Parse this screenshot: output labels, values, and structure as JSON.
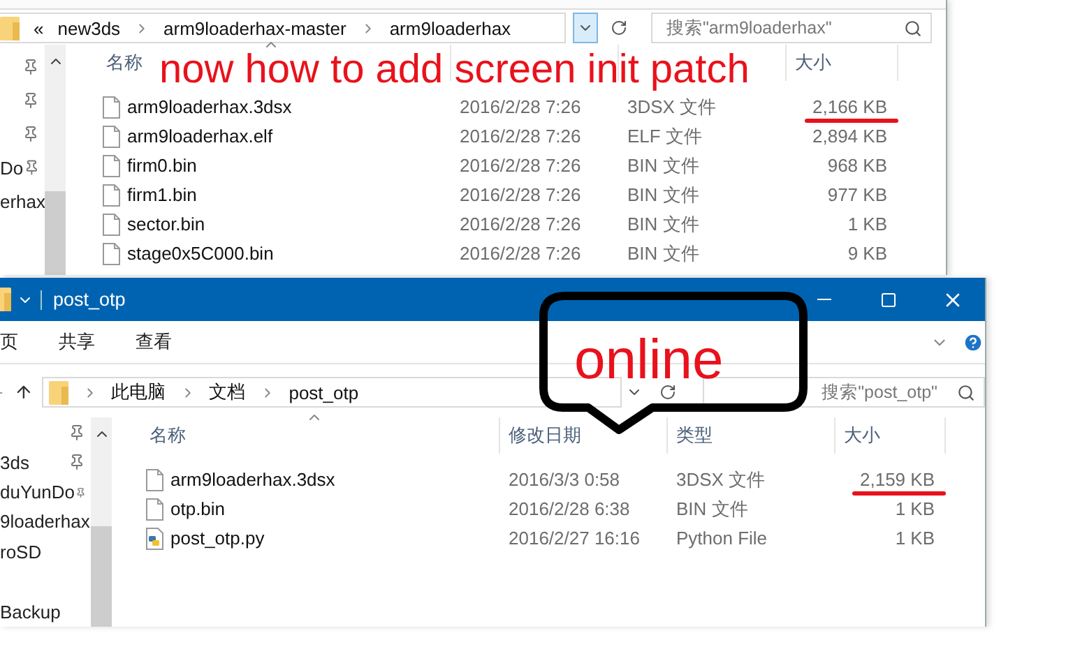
{
  "back_window": {
    "address": {
      "overflow": "«",
      "segments": [
        "new3ds",
        "arm9loaderhax-master",
        "arm9loaderhax"
      ],
      "dropdown_hover": true
    },
    "search": {
      "placeholder": "搜索\"arm9loaderhax\""
    },
    "sidebar": {
      "items": [
        {
          "pinned": true
        },
        {
          "pinned": true
        },
        {
          "pinned": true
        },
        {
          "label": "Do",
          "pinned": true
        },
        {
          "label": "erhax",
          "pinned": false
        }
      ]
    },
    "columns": [
      "名称",
      "大小"
    ],
    "rows": [
      {
        "name": "arm9loaderhax.3dsx",
        "date": "2016/2/28 7:26",
        "type": "3DSX 文件",
        "size": "2,166 KB",
        "underlined": true,
        "kind": "file"
      },
      {
        "name": "arm9loaderhax.elf",
        "date": "2016/2/28 7:26",
        "type": "ELF 文件",
        "size": "2,894 KB",
        "underlined": false,
        "kind": "file"
      },
      {
        "name": "firm0.bin",
        "date": "2016/2/28 7:26",
        "type": "BIN 文件",
        "size": "968 KB",
        "underlined": false,
        "kind": "file"
      },
      {
        "name": "firm1.bin",
        "date": "2016/2/28 7:26",
        "type": "BIN 文件",
        "size": "977 KB",
        "underlined": false,
        "kind": "file"
      },
      {
        "name": "sector.bin",
        "date": "2016/2/28 7:26",
        "type": "BIN 文件",
        "size": "1 KB",
        "underlined": false,
        "kind": "file"
      },
      {
        "name": "stage0x5C000.bin",
        "date": "2016/2/28 7:26",
        "type": "BIN 文件",
        "size": "9 KB",
        "underlined": false,
        "kind": "file"
      }
    ]
  },
  "front_window": {
    "title": "post_otp",
    "ribbon_tabs": [
      "页",
      "共享",
      "查看"
    ],
    "address": {
      "segments": [
        "此电脑",
        "文档",
        "post_otp"
      ]
    },
    "search": {
      "placeholder": "搜索\"post_otp\""
    },
    "sidebar": {
      "items": [
        {
          "pinned": true
        },
        {
          "label": "3ds",
          "pinned": true
        },
        {
          "label": "duYunDo",
          "pinned": true
        },
        {
          "label": "9loaderhax",
          "pinned": false
        },
        {
          "label": "roSD",
          "pinned": false
        },
        {
          "pinned": false
        },
        {
          "label": "Backup",
          "pinned": false
        }
      ]
    },
    "columns": [
      "名称",
      "修改日期",
      "类型",
      "大小"
    ],
    "rows": [
      {
        "name": "arm9loaderhax.3dsx",
        "date": "2016/3/3 0:58",
        "type": "3DSX 文件",
        "size": "2,159 KB",
        "underlined": true,
        "kind": "file"
      },
      {
        "name": "otp.bin",
        "date": "2016/2/28 6:38",
        "type": "BIN 文件",
        "size": "1 KB",
        "underlined": false,
        "kind": "file"
      },
      {
        "name": "post_otp.py",
        "date": "2016/2/27 16:16",
        "type": "Python File",
        "size": "1 KB",
        "underlined": false,
        "kind": "python"
      }
    ]
  },
  "annotations": [
    {
      "kind": "text",
      "text": "now how to add screen init patch"
    },
    {
      "kind": "bubble",
      "text": "online"
    }
  ]
}
